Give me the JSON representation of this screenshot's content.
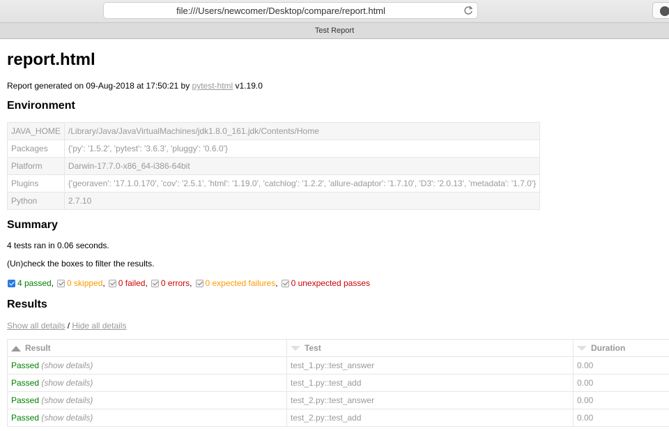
{
  "browser": {
    "url": "file:///Users/newcomer/Desktop/compare/report.html",
    "tab_title": "Test Report"
  },
  "report": {
    "title": "report.html",
    "generated_prefix": "Report generated on 09-Aug-2018 at 17:50:21 by ",
    "generated_link": "pytest-html",
    "generated_suffix": " v1.19.0"
  },
  "environment": {
    "heading": "Environment",
    "rows": [
      {
        "key": "JAVA_HOME",
        "value": "/Library/Java/JavaVirtualMachines/jdk1.8.0_161.jdk/Contents/Home"
      },
      {
        "key": "Packages",
        "value": "{'py': '1.5.2', 'pytest': '3.6.3', 'pluggy': '0.6.0'}"
      },
      {
        "key": "Platform",
        "value": "Darwin-17.7.0-x86_64-i386-64bit"
      },
      {
        "key": "Plugins",
        "value": "{'georaven': '17.1.0.170', 'cov': '2.5.1', 'html': '1.19.0', 'catchlog': '1.2.2', 'allure-adaptor': '1.7.10', 'D3': '2.0.13', 'metadata': '1.7.0'}"
      },
      {
        "key": "Python",
        "value": "2.7.10"
      }
    ]
  },
  "summary": {
    "heading": "Summary",
    "tests_ran": "4 tests ran in 0.06 seconds.",
    "uncheck_hint": "(Un)check the boxes to filter the results.",
    "filters": [
      {
        "label": "4 passed",
        "sep": ",",
        "class": "c-passed",
        "checked_style": "on"
      },
      {
        "label": "0 skipped",
        "sep": ",",
        "class": "c-skipped",
        "checked_style": "off"
      },
      {
        "label": "0 failed",
        "sep": ",",
        "class": "c-failed",
        "checked_style": "off"
      },
      {
        "label": "0 errors",
        "sep": ",",
        "class": "c-error",
        "checked_style": "off"
      },
      {
        "label": "0 expected failures",
        "sep": ",",
        "class": "c-xfail",
        "checked_style": "off"
      },
      {
        "label": "0 unexpected passes",
        "sep": "",
        "class": "c-xpass",
        "checked_style": "off"
      }
    ]
  },
  "results": {
    "heading": "Results",
    "show_all": "Show all details",
    "separator": " / ",
    "hide_all": "Hide all details",
    "columns": {
      "result": "Result",
      "test": "Test",
      "duration": "Duration"
    },
    "rows": [
      {
        "result": "Passed",
        "details": "(show details)",
        "test": "test_1.py::test_answer",
        "duration": "0.00"
      },
      {
        "result": "Passed",
        "details": "(show details)",
        "test": "test_1.py::test_add",
        "duration": "0.00"
      },
      {
        "result": "Passed",
        "details": "(show details)",
        "test": "test_2.py::test_answer",
        "duration": "0.00"
      },
      {
        "result": "Passed",
        "details": "(show details)",
        "test": "test_2.py::test_add",
        "duration": "0.00"
      }
    ]
  }
}
